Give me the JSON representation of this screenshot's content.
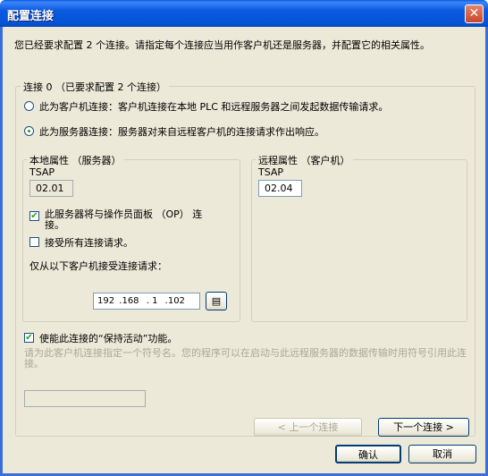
{
  "window": {
    "title": "配置连接"
  },
  "intro": "您已经要求配置 2 个连接。请指定每个连接应当用作客户机还是服务器，并配置它的相关属性。",
  "connection_group": {
    "legend": "连接 0 （已要求配置 2 个连接）",
    "radio_client": "此为客户机连接：客户机连接在本地 PLC 和远程服务器之间发起数据传输请求。",
    "radio_server": "此为服务器连接：服务器对来自远程客户机的连接请求作出响应。",
    "selected": "server"
  },
  "local": {
    "legend": "本地属性 （服务器）",
    "tsap_label": "TSAP",
    "tsap_value": "02.01",
    "op_panel_check": "此服务器将与操作员面板 （OP） 连接。",
    "op_panel_checked": true,
    "accept_all_check": "接受所有连接请求。",
    "accept_all_checked": false,
    "only_accept_label": "仅从以下客户机接受连接请求：",
    "ip": {
      "a": "192",
      "b": ".168",
      "c": ". 1",
      "d": ".102"
    },
    "ip_book_icon": "address-book-icon"
  },
  "remote": {
    "legend": "远程属性 （客户机）",
    "tsap_label": "TSAP",
    "tsap_value": "02.04"
  },
  "keepalive": {
    "label": "使能此连接的“保持活动”功能。",
    "checked": true
  },
  "symbol_hint": "请为此客户机连接指定一个符号名。您的程序可以在启动与此远程服务器的数据传输时用符号引用此连接。",
  "symbol_value": "",
  "buttons": {
    "prev": "< 上一个连接",
    "next": "下一个连接 >",
    "ok": "确认",
    "cancel": "取消"
  }
}
